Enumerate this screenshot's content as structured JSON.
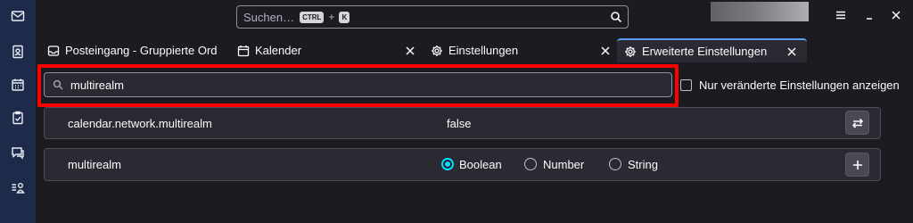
{
  "search": {
    "placeholder": "Suchen…",
    "shortcut_key1": "CTRL",
    "shortcut_plus": "+",
    "shortcut_key2": "K"
  },
  "tabs": [
    {
      "label": "Posteingang - Gruppierte Ord",
      "icon": "inbox-icon",
      "active": false,
      "closable": false
    },
    {
      "label": "Kalender",
      "icon": "calendar-icon",
      "active": false,
      "closable": true
    },
    {
      "label": "Einstellungen",
      "icon": "gear-icon",
      "active": false,
      "closable": true
    },
    {
      "label": "Erweiterte Einstellungen",
      "icon": "gear-icon",
      "active": true,
      "closable": true
    }
  ],
  "config": {
    "search_value": "multirealm",
    "modified_only_label": "Nur veränderte Einstellungen anzeigen",
    "modified_only_checked": false,
    "pref_row": {
      "name": "calendar.network.multirealm",
      "value": "false",
      "action": "toggle-icon"
    },
    "new_row": {
      "name": "multirealm",
      "types": [
        "Boolean",
        "Number",
        "String"
      ],
      "selected_type": "Boolean",
      "action": "add-icon"
    }
  },
  "colors": {
    "accent": "#00ddff",
    "highlight_box": "#ff0000",
    "spaces_bg": "#1e2a4a"
  }
}
